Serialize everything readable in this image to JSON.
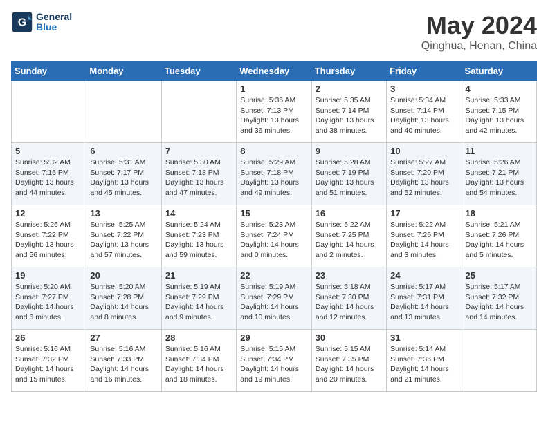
{
  "header": {
    "logo_line1": "General",
    "logo_line2": "Blue",
    "month": "May 2024",
    "location": "Qinghua, Henan, China"
  },
  "weekdays": [
    "Sunday",
    "Monday",
    "Tuesday",
    "Wednesday",
    "Thursday",
    "Friday",
    "Saturday"
  ],
  "weeks": [
    [
      {
        "day": "",
        "info": ""
      },
      {
        "day": "",
        "info": ""
      },
      {
        "day": "",
        "info": ""
      },
      {
        "day": "1",
        "info": "Sunrise: 5:36 AM\nSunset: 7:13 PM\nDaylight: 13 hours and 36 minutes."
      },
      {
        "day": "2",
        "info": "Sunrise: 5:35 AM\nSunset: 7:14 PM\nDaylight: 13 hours and 38 minutes."
      },
      {
        "day": "3",
        "info": "Sunrise: 5:34 AM\nSunset: 7:14 PM\nDaylight: 13 hours and 40 minutes."
      },
      {
        "day": "4",
        "info": "Sunrise: 5:33 AM\nSunset: 7:15 PM\nDaylight: 13 hours and 42 minutes."
      }
    ],
    [
      {
        "day": "5",
        "info": "Sunrise: 5:32 AM\nSunset: 7:16 PM\nDaylight: 13 hours and 44 minutes."
      },
      {
        "day": "6",
        "info": "Sunrise: 5:31 AM\nSunset: 7:17 PM\nDaylight: 13 hours and 45 minutes."
      },
      {
        "day": "7",
        "info": "Sunrise: 5:30 AM\nSunset: 7:18 PM\nDaylight: 13 hours and 47 minutes."
      },
      {
        "day": "8",
        "info": "Sunrise: 5:29 AM\nSunset: 7:18 PM\nDaylight: 13 hours and 49 minutes."
      },
      {
        "day": "9",
        "info": "Sunrise: 5:28 AM\nSunset: 7:19 PM\nDaylight: 13 hours and 51 minutes."
      },
      {
        "day": "10",
        "info": "Sunrise: 5:27 AM\nSunset: 7:20 PM\nDaylight: 13 hours and 52 minutes."
      },
      {
        "day": "11",
        "info": "Sunrise: 5:26 AM\nSunset: 7:21 PM\nDaylight: 13 hours and 54 minutes."
      }
    ],
    [
      {
        "day": "12",
        "info": "Sunrise: 5:26 AM\nSunset: 7:22 PM\nDaylight: 13 hours and 56 minutes."
      },
      {
        "day": "13",
        "info": "Sunrise: 5:25 AM\nSunset: 7:22 PM\nDaylight: 13 hours and 57 minutes."
      },
      {
        "day": "14",
        "info": "Sunrise: 5:24 AM\nSunset: 7:23 PM\nDaylight: 13 hours and 59 minutes."
      },
      {
        "day": "15",
        "info": "Sunrise: 5:23 AM\nSunset: 7:24 PM\nDaylight: 14 hours and 0 minutes."
      },
      {
        "day": "16",
        "info": "Sunrise: 5:22 AM\nSunset: 7:25 PM\nDaylight: 14 hours and 2 minutes."
      },
      {
        "day": "17",
        "info": "Sunrise: 5:22 AM\nSunset: 7:26 PM\nDaylight: 14 hours and 3 minutes."
      },
      {
        "day": "18",
        "info": "Sunrise: 5:21 AM\nSunset: 7:26 PM\nDaylight: 14 hours and 5 minutes."
      }
    ],
    [
      {
        "day": "19",
        "info": "Sunrise: 5:20 AM\nSunset: 7:27 PM\nDaylight: 14 hours and 6 minutes."
      },
      {
        "day": "20",
        "info": "Sunrise: 5:20 AM\nSunset: 7:28 PM\nDaylight: 14 hours and 8 minutes."
      },
      {
        "day": "21",
        "info": "Sunrise: 5:19 AM\nSunset: 7:29 PM\nDaylight: 14 hours and 9 minutes."
      },
      {
        "day": "22",
        "info": "Sunrise: 5:19 AM\nSunset: 7:29 PM\nDaylight: 14 hours and 10 minutes."
      },
      {
        "day": "23",
        "info": "Sunrise: 5:18 AM\nSunset: 7:30 PM\nDaylight: 14 hours and 12 minutes."
      },
      {
        "day": "24",
        "info": "Sunrise: 5:17 AM\nSunset: 7:31 PM\nDaylight: 14 hours and 13 minutes."
      },
      {
        "day": "25",
        "info": "Sunrise: 5:17 AM\nSunset: 7:32 PM\nDaylight: 14 hours and 14 minutes."
      }
    ],
    [
      {
        "day": "26",
        "info": "Sunrise: 5:16 AM\nSunset: 7:32 PM\nDaylight: 14 hours and 15 minutes."
      },
      {
        "day": "27",
        "info": "Sunrise: 5:16 AM\nSunset: 7:33 PM\nDaylight: 14 hours and 16 minutes."
      },
      {
        "day": "28",
        "info": "Sunrise: 5:16 AM\nSunset: 7:34 PM\nDaylight: 14 hours and 18 minutes."
      },
      {
        "day": "29",
        "info": "Sunrise: 5:15 AM\nSunset: 7:34 PM\nDaylight: 14 hours and 19 minutes."
      },
      {
        "day": "30",
        "info": "Sunrise: 5:15 AM\nSunset: 7:35 PM\nDaylight: 14 hours and 20 minutes."
      },
      {
        "day": "31",
        "info": "Sunrise: 5:14 AM\nSunset: 7:36 PM\nDaylight: 14 hours and 21 minutes."
      },
      {
        "day": "",
        "info": ""
      }
    ]
  ]
}
